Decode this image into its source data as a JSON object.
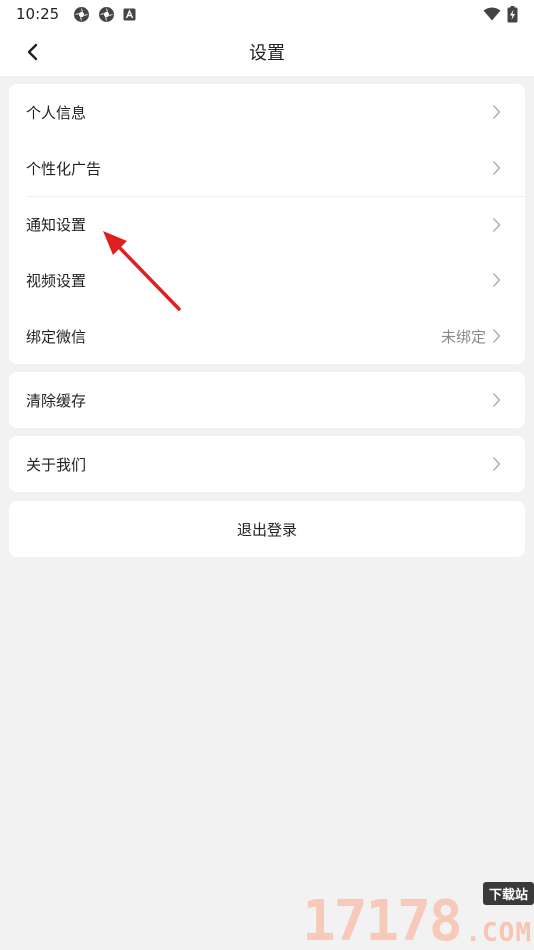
{
  "status_bar": {
    "time": "10:25",
    "icons": [
      "sync-icon",
      "sync-icon",
      "app-notification-icon",
      "wifi-icon",
      "battery-charging-icon"
    ]
  },
  "nav": {
    "back_icon": "chevron-left-icon",
    "title": "设置"
  },
  "groups": {
    "main": [
      {
        "label": "个人信息",
        "value": ""
      },
      {
        "label": "个性化广告",
        "value": ""
      },
      {
        "label": "通知设置",
        "value": ""
      },
      {
        "label": "视频设置",
        "value": ""
      },
      {
        "label": "绑定微信",
        "value": "未绑定"
      }
    ],
    "cache": {
      "label": "清除缓存"
    },
    "about": {
      "label": "关于我们"
    }
  },
  "logout": {
    "label": "退出登录"
  },
  "watermark": {
    "digits": "17178",
    "badge": "下载站",
    "domain": ".COM"
  },
  "colors": {
    "background": "#f2f2f2",
    "card": "#ffffff",
    "text": "#222222",
    "muted": "#888888",
    "chevron": "#b0b0b0",
    "annotation": "#e02020"
  }
}
